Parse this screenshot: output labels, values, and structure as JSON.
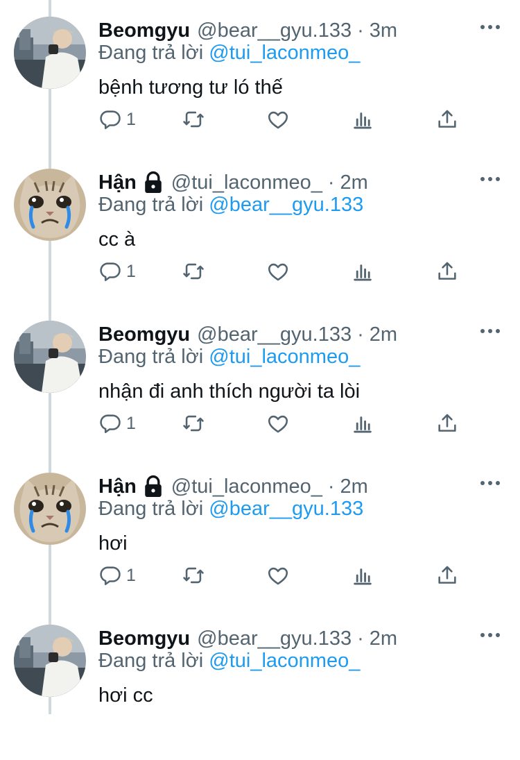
{
  "tweets": [
    {
      "name": "Beomgyu",
      "locked": false,
      "handle": "@bear__gyu.133",
      "dot": "·",
      "time": "3m",
      "reply_prefix": "Đang trả lời",
      "reply_to": "@tui_laconmeo_",
      "text": "bệnh tương tư ló thế",
      "reply_count": "1",
      "avatar": "boy-photo"
    },
    {
      "name": "Hận",
      "locked": true,
      "handle": "@tui_laconmeo_",
      "dot": "·",
      "time": "2m",
      "reply_prefix": "Đang trả lời",
      "reply_to": "@bear__gyu.133",
      "text": "cc à",
      "reply_count": "1",
      "avatar": "crying-cat"
    },
    {
      "name": "Beomgyu",
      "locked": false,
      "handle": "@bear__gyu.133",
      "dot": "·",
      "time": "2m",
      "reply_prefix": "Đang trả lời",
      "reply_to": "@tui_laconmeo_",
      "text": "nhận đi anh thích người ta lòi",
      "reply_count": "1",
      "avatar": "boy-photo"
    },
    {
      "name": "Hận",
      "locked": true,
      "handle": "@tui_laconmeo_",
      "dot": "·",
      "time": "2m",
      "reply_prefix": "Đang trả lời",
      "reply_to": "@bear__gyu.133",
      "text": "hơi",
      "reply_count": "1",
      "avatar": "crying-cat"
    },
    {
      "name": "Beomgyu",
      "locked": false,
      "handle": "@bear__gyu.133",
      "dot": "·",
      "time": "2m",
      "reply_prefix": "Đang trả lời",
      "reply_to": "@tui_laconmeo_",
      "text": "hơi cc",
      "reply_count": "",
      "avatar": "boy-photo"
    }
  ],
  "icons": {
    "reply": "comment-icon",
    "retweet": "retweet-icon",
    "like": "heart-icon",
    "analytics": "analytics-icon",
    "share": "share-icon",
    "more": "more-icon",
    "lock": "lock-icon"
  },
  "colors": {
    "text": "#0f1419",
    "secondary": "#536471",
    "link": "#1d9bf0",
    "thread_line": "#cfd9de"
  }
}
